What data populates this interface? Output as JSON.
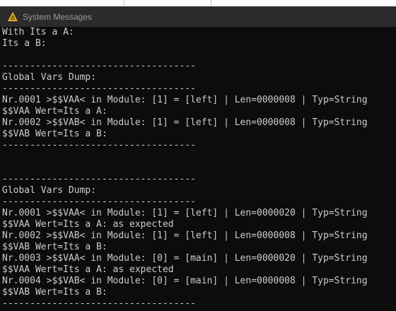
{
  "window": {
    "title": "System Messages",
    "icon": "triangle-app-icon",
    "background": "#0c0c0c",
    "text_color": "#cccccc"
  },
  "console": {
    "lines": [
      "With Its a A:",
      "Its a B:",
      "",
      "-----------------------------------",
      "Global Vars Dump:",
      "-----------------------------------",
      "Nr.0001 >$$VAA< in Module: [1] = [left] | Len=0000008 | Typ=String",
      "$$VAA Wert=Its a A:",
      "Nr.0002 >$$VAB< in Module: [1] = [left] | Len=0000008 | Typ=String",
      "$$VAB Wert=Its a B:",
      "-----------------------------------",
      "",
      "",
      "-----------------------------------",
      "Global Vars Dump:",
      "-----------------------------------",
      "Nr.0001 >$$VAA< in Module: [1] = [left] | Len=0000020 | Typ=String",
      "$$VAA Wert=Its a A: as expected",
      "Nr.0002 >$$VAB< in Module: [1] = [left] | Len=0000008 | Typ=String",
      "$$VAB Wert=Its a B:",
      "Nr.0003 >$$VAA< in Module: [0] = [main] | Len=0000020 | Typ=String",
      "$$VAA Wert=Its a A: as expected",
      "Nr.0004 >$$VAB< in Module: [0] = [main] | Len=0000008 | Typ=String",
      "$$VAB Wert=Its a B:",
      "-----------------------------------"
    ]
  }
}
